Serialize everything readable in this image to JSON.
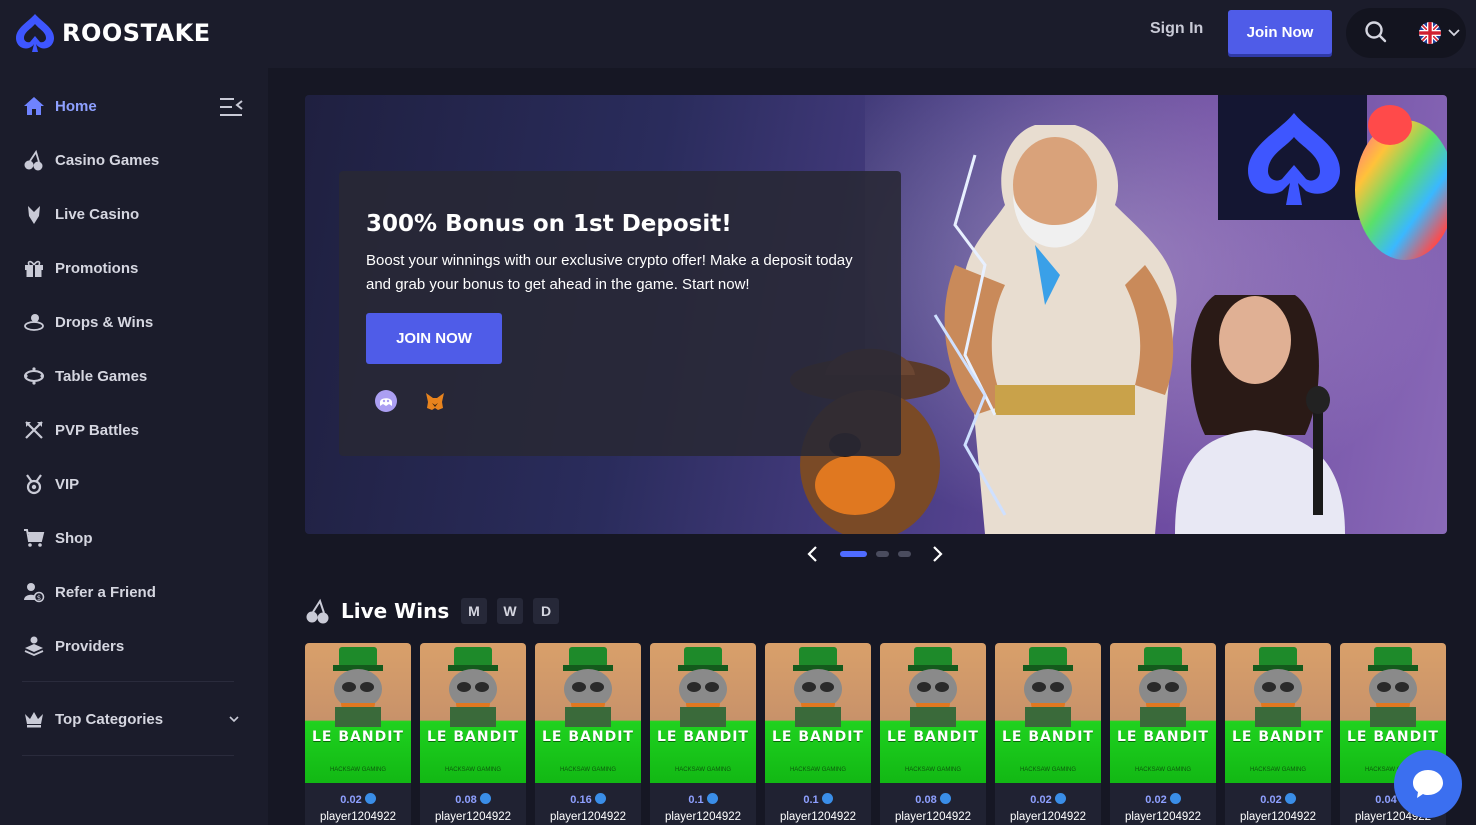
{
  "header": {
    "logo_text": "ROOSTAKE",
    "sign_in": "Sign In",
    "join_now": "Join Now"
  },
  "sidebar": {
    "items": [
      {
        "label": "Home",
        "icon": "home-icon"
      },
      {
        "label": "Casino Games",
        "icon": "cherries-icon"
      },
      {
        "label": "Live Casino",
        "icon": "joker-icon"
      },
      {
        "label": "Promotions",
        "icon": "gift-icon"
      },
      {
        "label": "Drops & Wins",
        "icon": "drops-wins-icon"
      },
      {
        "label": "Table Games",
        "icon": "table-icon"
      },
      {
        "label": "PVP Battles",
        "icon": "swords-icon"
      },
      {
        "label": "VIP",
        "icon": "medal-icon"
      },
      {
        "label": "Shop",
        "icon": "cart-icon"
      },
      {
        "label": "Refer a Friend",
        "icon": "refer-icon"
      },
      {
        "label": "Providers",
        "icon": "providers-icon"
      }
    ],
    "top_categories": "Top Categories"
  },
  "banner": {
    "title": "300% Bonus on 1st Deposit!",
    "text": "Boost your winnings with our exclusive crypto offer! Make a deposit today and grab your bonus to get ahead in the game. Start now!",
    "button": "JOIN NOW"
  },
  "live_wins": {
    "title": "Live Wins",
    "tabs": [
      "M",
      "W",
      "D"
    ],
    "cards": [
      {
        "game": "LE BANDIT",
        "provider": "HACKSAW GAMING",
        "amount": "0.02",
        "player": "player1204922"
      },
      {
        "game": "LE BANDIT",
        "provider": "HACKSAW GAMING",
        "amount": "0.08",
        "player": "player1204922"
      },
      {
        "game": "LE BANDIT",
        "provider": "HACKSAW GAMING",
        "amount": "0.16",
        "player": "player1204922"
      },
      {
        "game": "LE BANDIT",
        "provider": "HACKSAW GAMING",
        "amount": "0.1",
        "player": "player1204922"
      },
      {
        "game": "LE BANDIT",
        "provider": "HACKSAW GAMING",
        "amount": "0.1",
        "player": "player1204922"
      },
      {
        "game": "LE BANDIT",
        "provider": "HACKSAW GAMING",
        "amount": "0.08",
        "player": "player1204922"
      },
      {
        "game": "LE BANDIT",
        "provider": "HACKSAW GAMING",
        "amount": "0.02",
        "player": "player1204922"
      },
      {
        "game": "LE BANDIT",
        "provider": "HACKSAW GAMING",
        "amount": "0.02",
        "player": "player1204922"
      },
      {
        "game": "LE BANDIT",
        "provider": "HACKSAW GAMING",
        "amount": "0.02",
        "player": "player1204922"
      },
      {
        "game": "LE BANDIT",
        "provider": "HACKSAW GAMING",
        "amount": "0.04",
        "player": "player1204922"
      }
    ]
  },
  "colors": {
    "accent": "#4f5ce8",
    "active_nav": "#8ea0ff",
    "background": "#161724",
    "panel": "#1b1c2b",
    "chat": "#3b6ff0"
  }
}
